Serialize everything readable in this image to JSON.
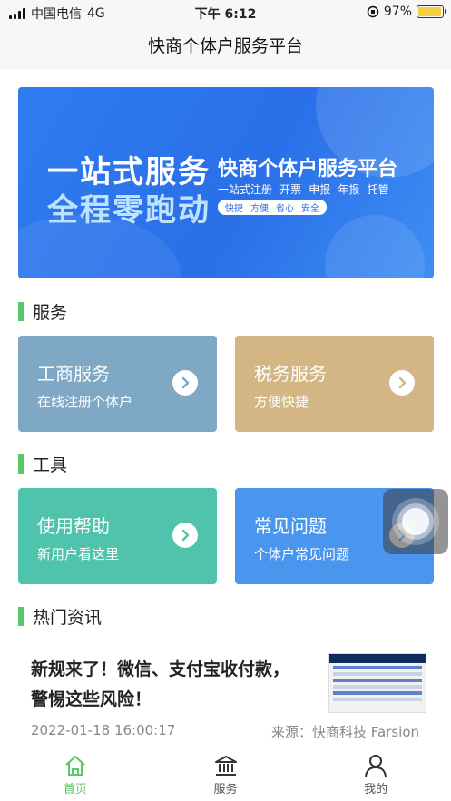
{
  "status_bar": {
    "carrier": "中国电信",
    "network": "4G",
    "time": "下午 6:12",
    "battery": "97%",
    "battery_level": 0.97
  },
  "nav": {
    "title": "快商个体户服务平台"
  },
  "banner": {
    "slogan_line1": "一站式服务",
    "slogan_line2": "全程零跑动",
    "title": "快商个体户服务平台",
    "subtitle": "一站式注册 -开票 -申报 -年报 -托管",
    "tags": [
      "快捷",
      "方便",
      "省心",
      "安全"
    ]
  },
  "services": {
    "heading": "服务",
    "cards": [
      {
        "title": "工商服务",
        "desc": "在线注册个体户",
        "color": "#7ea8c3"
      },
      {
        "title": "税务服务",
        "desc": "方便快捷",
        "color": "#d4b684"
      }
    ]
  },
  "tools": {
    "heading": "工具",
    "cards": [
      {
        "title": "使用帮助",
        "desc": "新用户看这里",
        "color": "#4fc3ab"
      },
      {
        "title": "常见问题",
        "desc": "个体户常见问题",
        "color": "#4a96ef"
      }
    ]
  },
  "news": {
    "heading": "热门资讯",
    "items": [
      {
        "headline": "新规来了！微信、支付宝收付款，警惕这些风险！",
        "date": "2022-01-18 16:00:17",
        "source": "来源：快商科技 Farsion"
      }
    ]
  },
  "tab_bar": {
    "items": [
      {
        "label": "首页",
        "icon": "home-icon",
        "active": true
      },
      {
        "label": "服务",
        "icon": "bank-icon",
        "active": false
      },
      {
        "label": "我的",
        "icon": "person-icon",
        "active": false
      }
    ],
    "active_color": "#5cc66a"
  }
}
